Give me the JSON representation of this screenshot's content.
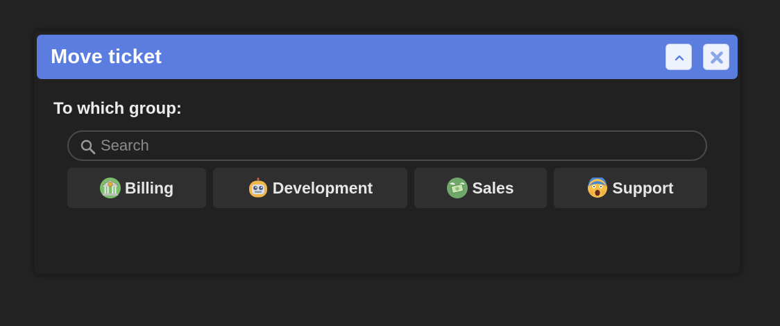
{
  "dialog": {
    "title": "Move ticket",
    "collapse_icon": "chevron-up-icon",
    "close_icon": "close-icon",
    "accent_color": "#5b7de0"
  },
  "form": {
    "label": "To which group:",
    "search": {
      "placeholder": "Search",
      "value": "",
      "icon": "search-icon"
    },
    "groups": [
      {
        "label": "Billing",
        "icon": "bank-icon"
      },
      {
        "label": "Development",
        "icon": "robot-icon"
      },
      {
        "label": "Sales",
        "icon": "money-with-wings-icon"
      },
      {
        "label": "Support",
        "icon": "screaming-face-icon"
      }
    ]
  }
}
